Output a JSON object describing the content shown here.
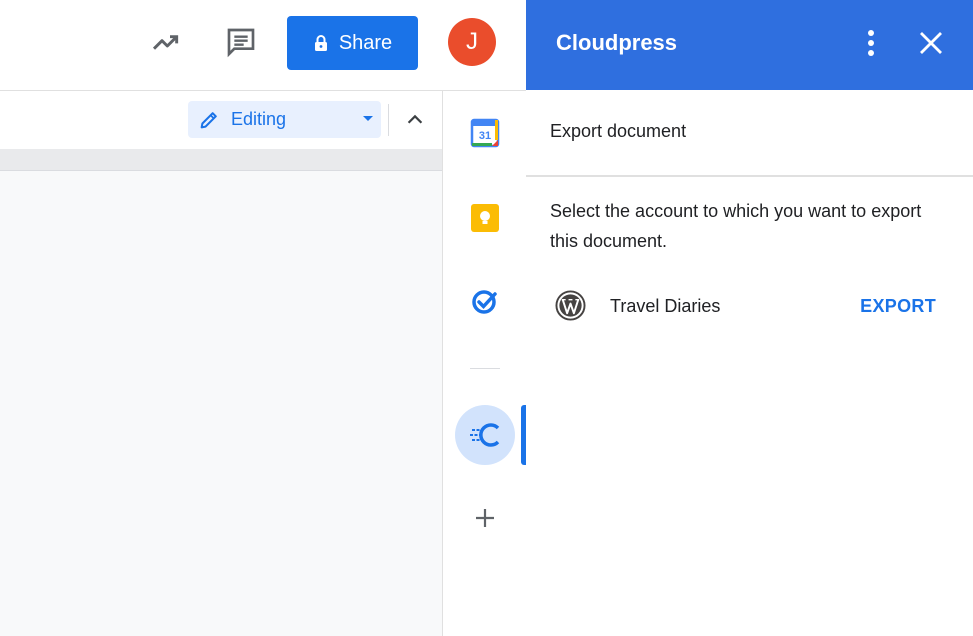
{
  "header": {
    "share_label": "Share",
    "avatar_initial": "J",
    "icons": [
      "trending-icon",
      "comment-icon",
      "lock-icon"
    ],
    "share_color": "#1a73e8",
    "avatar_color": "#ea4d2c"
  },
  "toolbar": {
    "mode_label": "Editing",
    "icons": [
      "pencil-icon",
      "dropdown-caret-icon",
      "chevron-up-icon"
    ]
  },
  "rail": {
    "items": [
      {
        "name": "calendar",
        "label": "31"
      },
      {
        "name": "keep",
        "label": ""
      },
      {
        "name": "tasks",
        "label": ""
      },
      {
        "name": "cloudpress",
        "label": ""
      },
      {
        "name": "add",
        "label": ""
      }
    ]
  },
  "panel": {
    "title": "Cloudpress",
    "header_color": "#2f6fdf",
    "subtitle": "Export document",
    "description": "Select the account to which you want to export this document.",
    "accounts": [
      {
        "name": "Travel Diaries",
        "action": "EXPORT",
        "icon": "wordpress-icon"
      }
    ]
  }
}
